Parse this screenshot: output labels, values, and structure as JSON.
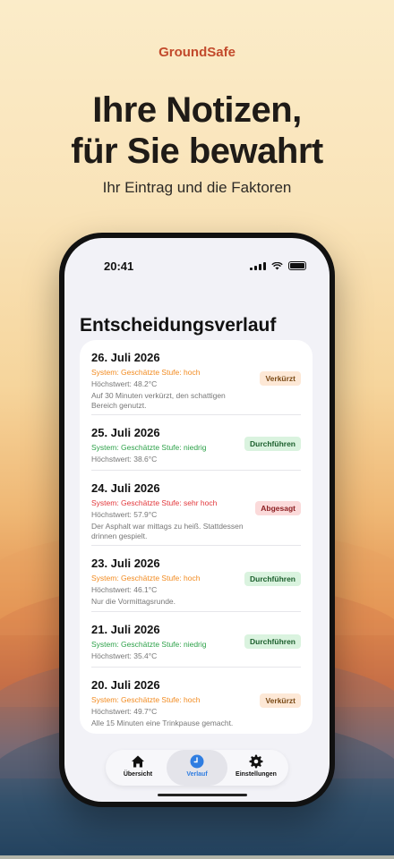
{
  "brand": "GroundSafe",
  "headline_line1": "Ihre Notizen,",
  "headline_line2": "für Sie bewahrt",
  "subline": "Ihr Eintrag und die Faktoren",
  "status_bar": {
    "time": "20:41"
  },
  "page_title": "Entscheidungsverlauf",
  "entries": [
    {
      "date": "26. Juli 2026",
      "system": "System: Geschätzte Stufe: hoch",
      "max": "Höchstwert: 48.2°C",
      "note": "Auf 30 Minuten verkürzt, den schattigen Bereich genutzt.",
      "badge": "Verkürzt"
    },
    {
      "date": "25. Juli 2026",
      "system": "System: Geschätzte Stufe: niedrig",
      "max": "Höchstwert: 38.6°C",
      "note": "",
      "badge": "Durchführen"
    },
    {
      "date": "24. Juli 2026",
      "system": "System: Geschätzte Stufe: sehr hoch",
      "max": "Höchstwert: 57.9°C",
      "note": "Der Asphalt war mittags zu heiß. Stattdessen drinnen gespielt.",
      "badge": "Abgesagt"
    },
    {
      "date": "23. Juli 2026",
      "system": "System: Geschätzte Stufe: hoch",
      "max": "Höchstwert: 46.1°C",
      "note": "Nur die Vormittagsrunde.",
      "badge": "Durchführen"
    },
    {
      "date": "21. Juli 2026",
      "system": "System: Geschätzte Stufe: niedrig",
      "max": "Höchstwert: 35.4°C",
      "note": "",
      "badge": "Durchführen"
    },
    {
      "date": "20. Juli 2026",
      "system": "System: Geschätzte Stufe: hoch",
      "max": "Höchstwert: 49.7°C",
      "note": "Alle 15 Minuten eine Trinkpause gemacht.",
      "badge": "Verkürzt"
    }
  ],
  "tabs": [
    {
      "label": "Übersicht",
      "icon": "house-icon"
    },
    {
      "label": "Verlauf",
      "icon": "clock-icon"
    },
    {
      "label": "Einstellungen",
      "icon": "gear-icon"
    }
  ],
  "colors": {
    "brand": "#c24a2c",
    "accent": "#2f7de1",
    "level_high": "#f28b20",
    "level_low": "#2ea24a",
    "level_very_high": "#e2363a"
  }
}
